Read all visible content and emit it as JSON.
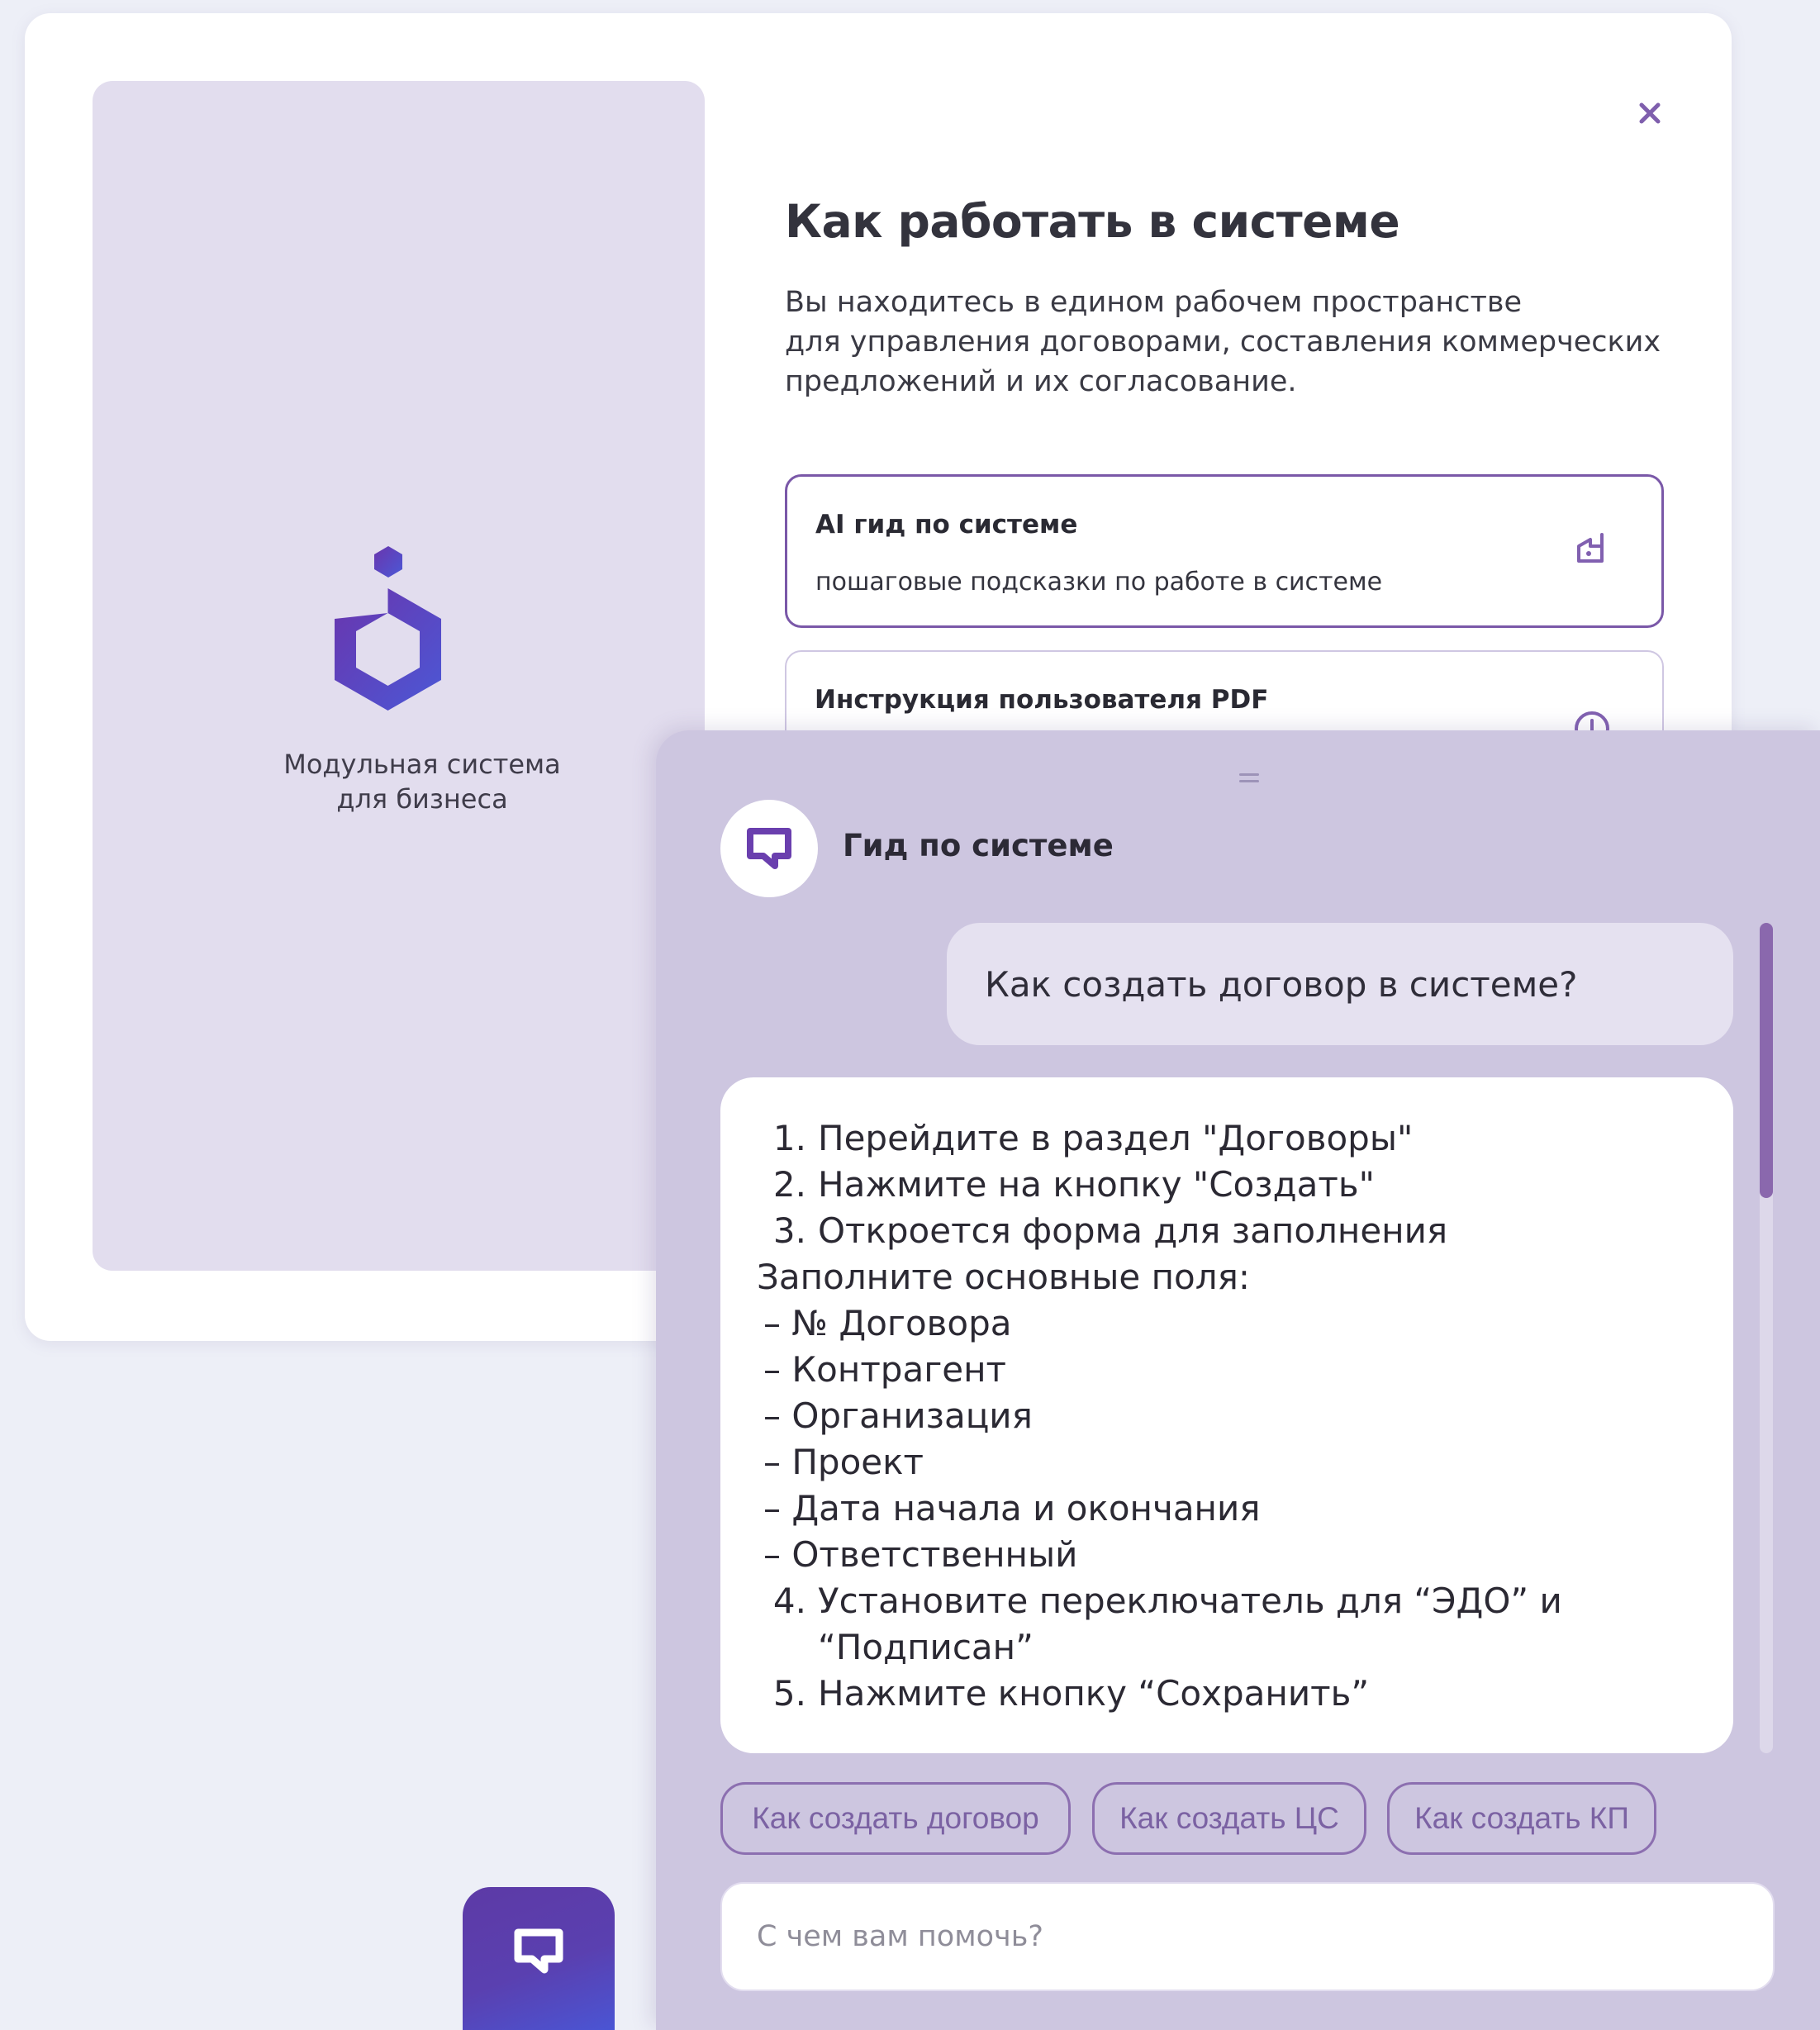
{
  "colors": {
    "accent": "#5d3aa6",
    "accent_blue": "#4a55d4",
    "chip_border": "#8c6fb0",
    "panel": "#cdc6e0",
    "brand_panel": "#e2ddee"
  },
  "brand": {
    "logo_icon": "hexagon-logo-icon",
    "caption_line1": "Модульная система",
    "caption_line2": "для бизнеса"
  },
  "modal": {
    "close_icon": "close-icon",
    "title": "Как работать в системе",
    "description": [
      "Вы находитесь в едином рабочем пространстве",
      "для управления договорами, составления коммерческих",
      "предложений и их согласование."
    ],
    "options": [
      {
        "title": "AI гид по системе",
        "subtitle": "пошаговые подсказки по работе в системе",
        "icon": "ai-guide-icon"
      },
      {
        "title": "Инструкция пользователя PDF",
        "icon": "download-icon"
      }
    ]
  },
  "chat": {
    "drag_icon": "drag-handle-icon",
    "avatar_icon": "chat-bubble-icon",
    "title": "Гид по системе",
    "user_message": "Как создать договор в системе?",
    "bot_message": {
      "steps_1": [
        {
          "num": "1.",
          "text": "Перейдите в раздел \"Договоры\""
        },
        {
          "num": "2.",
          "text": "Нажмите на кнопку \"Создать\""
        },
        {
          "num": "3.",
          "text": "Откроется форма для заполнения"
        }
      ],
      "fields_intro": "Заполните основные поля:",
      "fields": [
        "– № Договора",
        "– Контрагент",
        "– Организация",
        "– Проект",
        "– Дата начала и окончания",
        "– Ответственный"
      ],
      "step_4": {
        "num": "4.",
        "text": "Установите переключатель для “ЭДО” и",
        "cont": "“Подписан”"
      },
      "step_5": {
        "num": "5.",
        "text": "Нажмите кнопку “Сохранить”"
      }
    },
    "suggestions": [
      "Как создать договор",
      "Как создать ЦС",
      "Как создать КП"
    ],
    "input": {
      "placeholder": "С чем вам помочь?",
      "value": ""
    }
  },
  "launcher": {
    "icon": "chat-bubble-icon"
  }
}
